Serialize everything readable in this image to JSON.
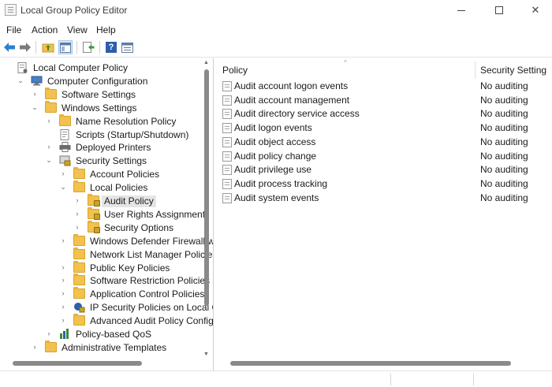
{
  "window": {
    "title": "Local Group Policy Editor",
    "minimize_icon": "minimize-icon",
    "maximize_icon": "maximize-icon",
    "close_glyph": "✕"
  },
  "menu": [
    {
      "label": "File"
    },
    {
      "label": "Action"
    },
    {
      "label": "View"
    },
    {
      "label": "Help"
    }
  ],
  "toolbar": {
    "icons": [
      "back-arrow-icon",
      "forward-arrow-icon",
      "up-folder-icon",
      "show-hide-tree-icon",
      "export-list-icon",
      "help-icon",
      "properties-icon"
    ],
    "help_glyph": "?"
  },
  "tree": [
    {
      "label": "Local Computer Policy",
      "icon": "policy-document-icon",
      "arrow": ""
    },
    {
      "label": "Computer Configuration",
      "icon": "computer-icon",
      "arrow": "⌄"
    },
    {
      "label": "Software Settings",
      "icon": "folder-icon",
      "arrow": "›"
    },
    {
      "label": "Windows Settings",
      "icon": "folder-icon",
      "arrow": "⌄"
    },
    {
      "label": "Name Resolution Policy",
      "icon": "folder-icon",
      "arrow": "›"
    },
    {
      "label": "Scripts (Startup/Shutdown)",
      "icon": "script-icon",
      "arrow": ""
    },
    {
      "label": "Deployed Printers",
      "icon": "printer-icon",
      "arrow": "›"
    },
    {
      "label": "Security Settings",
      "icon": "security-settings-icon",
      "arrow": "⌄"
    },
    {
      "label": "Account Policies",
      "icon": "folder-icon",
      "arrow": "›"
    },
    {
      "label": "Local Policies",
      "icon": "folder-icon",
      "arrow": "⌄"
    },
    {
      "label": "Audit Policy",
      "icon": "locked-folder-icon",
      "arrow": "›",
      "selected": true
    },
    {
      "label": "User Rights Assignment",
      "icon": "locked-folder-icon",
      "arrow": "›"
    },
    {
      "label": "Security Options",
      "icon": "locked-folder-icon",
      "arrow": "›"
    },
    {
      "label": "Windows Defender Firewall with A",
      "icon": "folder-icon",
      "arrow": "›"
    },
    {
      "label": "Network List Manager Policies",
      "icon": "folder-icon",
      "arrow": ""
    },
    {
      "label": "Public Key Policies",
      "icon": "folder-icon",
      "arrow": "›"
    },
    {
      "label": "Software Restriction Policies",
      "icon": "folder-icon",
      "arrow": "›"
    },
    {
      "label": "Application Control Policies",
      "icon": "folder-icon",
      "arrow": "›"
    },
    {
      "label": "IP Security Policies on Local Comp",
      "icon": "ip-security-icon",
      "arrow": "›"
    },
    {
      "label": "Advanced Audit Policy Configura",
      "icon": "folder-icon",
      "arrow": "›"
    },
    {
      "label": "Policy-based QoS",
      "icon": "qos-chart-icon",
      "arrow": "›"
    },
    {
      "label": "Administrative Templates",
      "icon": "folder-icon",
      "arrow": "›"
    }
  ],
  "list": {
    "columns": {
      "policy": "Policy",
      "setting": "Security Setting"
    },
    "sort_caret": "^",
    "rows": [
      {
        "policy": "Audit account logon events",
        "setting": "No auditing"
      },
      {
        "policy": "Audit account management",
        "setting": "No auditing"
      },
      {
        "policy": "Audit directory service access",
        "setting": "No auditing"
      },
      {
        "policy": "Audit logon events",
        "setting": "No auditing"
      },
      {
        "policy": "Audit object access",
        "setting": "No auditing"
      },
      {
        "policy": "Audit policy change",
        "setting": "No auditing"
      },
      {
        "policy": "Audit privilege use",
        "setting": "No auditing"
      },
      {
        "policy": "Audit process tracking",
        "setting": "No auditing"
      },
      {
        "policy": "Audit system events",
        "setting": "No auditing"
      }
    ]
  },
  "colors": {
    "folder": "#f2c14e",
    "selection": "#e5e5e5",
    "scroll_thumb": "#8a8a8a",
    "back_arrow": "#2b7fd4",
    "forward_arrow": "#7a7a7a"
  }
}
